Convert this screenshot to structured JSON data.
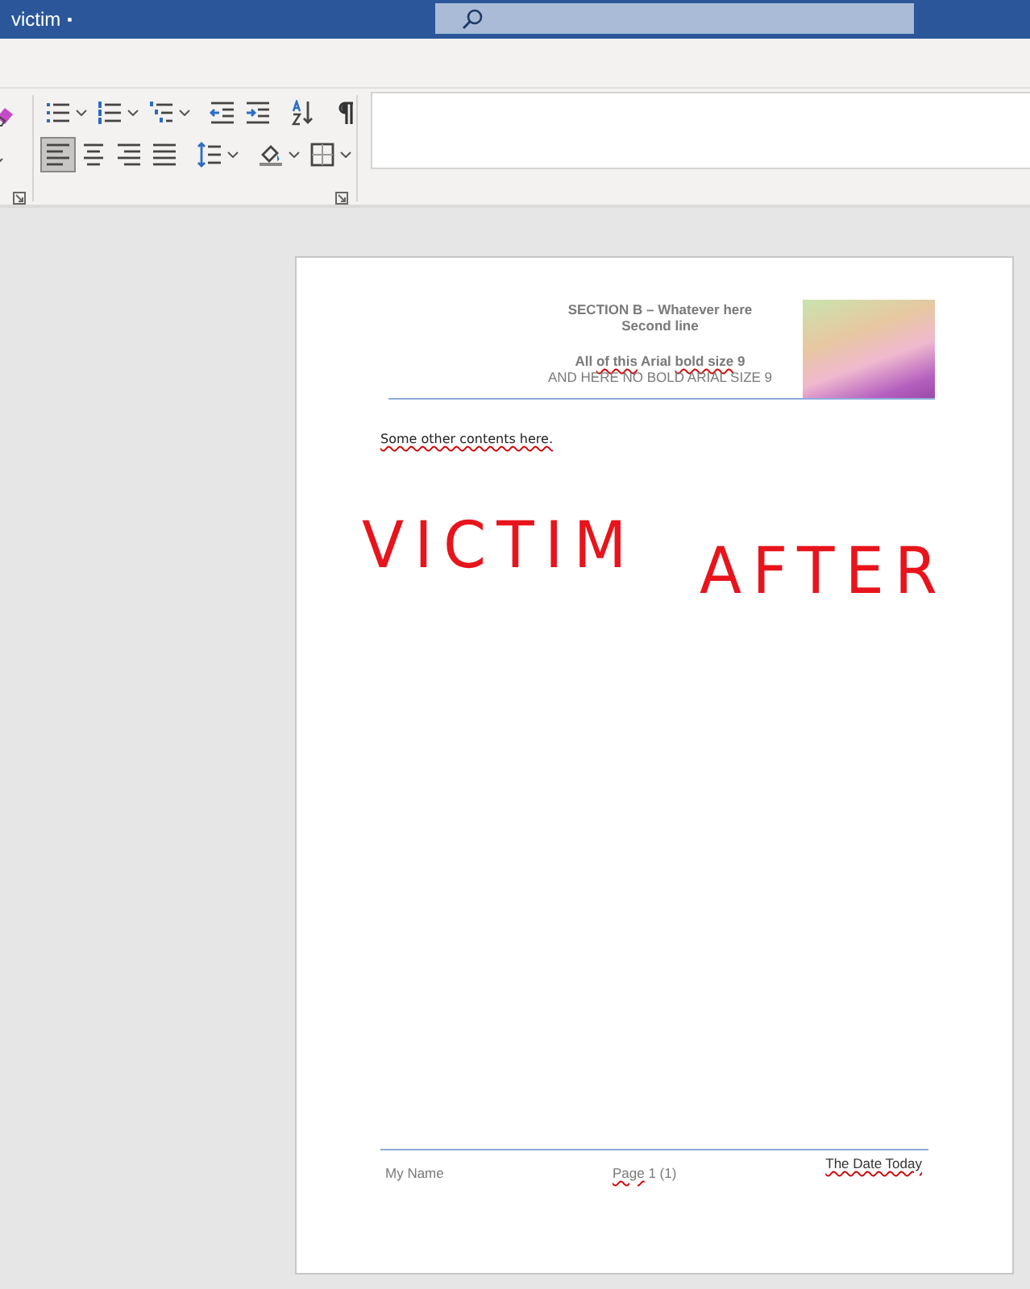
{
  "window": {
    "title": "victim",
    "status_mark": "▪"
  },
  "ribbon": {
    "left_group": [
      {
        "kind": "eraser",
        "dropdown": false
      },
      {
        "kind": "blank",
        "dropdown": true
      }
    ],
    "paragraph_row_1": [
      {
        "kind": "bullets",
        "dropdown": true
      },
      {
        "kind": "numbering",
        "dropdown": true
      },
      {
        "kind": "multilevel",
        "dropdown": true
      },
      {
        "kind": "separator"
      },
      {
        "kind": "outdent",
        "dropdown": false
      },
      {
        "kind": "indent",
        "dropdown": false
      },
      {
        "kind": "separator"
      },
      {
        "kind": "sort",
        "dropdown": false
      },
      {
        "kind": "separator"
      },
      {
        "kind": "pilcrow",
        "dropdown": false
      }
    ],
    "paragraph_row_2": [
      {
        "kind": "alignleft",
        "dropdown": false,
        "selected": true
      },
      {
        "kind": "aligncenter",
        "dropdown": false,
        "selected": false
      },
      {
        "kind": "alignright",
        "dropdown": false,
        "selected": false
      },
      {
        "kind": "justify",
        "dropdown": false,
        "selected": false
      },
      {
        "kind": "separator"
      },
      {
        "kind": "spacing",
        "dropdown": true,
        "selected": false
      },
      {
        "kind": "separator"
      },
      {
        "kind": "shading",
        "dropdown": true,
        "selected": false
      },
      {
        "kind": "borders",
        "dropdown": true,
        "selected": false
      }
    ]
  },
  "document": {
    "header": {
      "lines": [
        {
          "bold": true,
          "segments": [
            {
              "text": "SECTION B – Whatever here",
              "misspelled": false
            }
          ]
        },
        {
          "bold": true,
          "segments": [
            {
              "text": "Second line",
              "misspelled": false
            }
          ]
        },
        {
          "bold": true,
          "segments": [
            {
              "text": "All ",
              "misspelled": false
            },
            {
              "text": "of this",
              "misspelled": true
            },
            {
              "text": " Arial ",
              "misspelled": false
            },
            {
              "text": "bold size",
              "misspelled": true
            },
            {
              "text": " 9",
              "misspelled": false
            }
          ]
        },
        {
          "bold": false,
          "segments": [
            {
              "text": "AND HERE NO BOLD ARIAL SIZE 9",
              "misspelled": false
            }
          ]
        }
      ]
    },
    "body": {
      "segments": [
        {
          "text": "Some other contents here.",
          "misspelled": true
        }
      ]
    },
    "ink": [
      "VICTIM",
      "AFTER"
    ],
    "footer": {
      "left": [
        {
          "text": "My Name",
          "misspelled": false
        }
      ],
      "center": [
        {
          "text": "Page",
          "misspelled": true
        },
        {
          "text": " 1 (1)",
          "misspelled": false
        }
      ],
      "right": [
        {
          "text": "The Date Today",
          "misspelled": true
        }
      ]
    }
  }
}
